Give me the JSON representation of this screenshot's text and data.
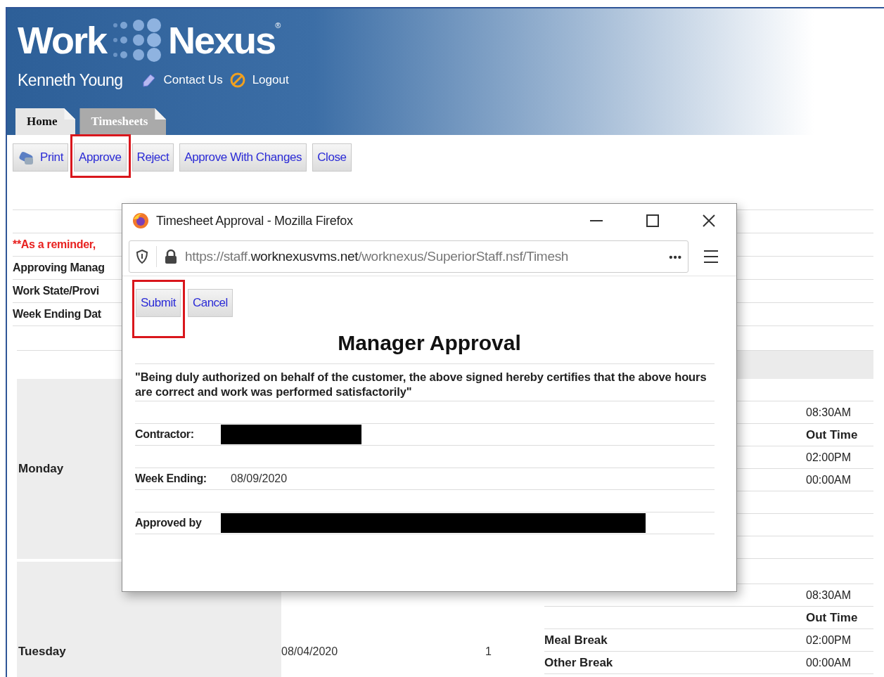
{
  "logo": {
    "word_1": "Work",
    "word_2": "Nexus",
    "mark": "®"
  },
  "user": {
    "name": "Kenneth Young",
    "links": [
      "Contact Us",
      "Logout"
    ]
  },
  "tabs": [
    {
      "label": "Home",
      "selected": true
    },
    {
      "label": "Timesheets",
      "selected": false
    }
  ],
  "toolbar": [
    {
      "label": "Print",
      "kind": "print",
      "highlighted": false
    },
    {
      "label": "Approve",
      "kind": "plain",
      "highlighted": true
    },
    {
      "label": "Reject",
      "kind": "plain",
      "highlighted": false
    },
    {
      "label": "Approve With Changes",
      "kind": "plain",
      "highlighted": false
    },
    {
      "label": "Close",
      "kind": "plain",
      "highlighted": false
    }
  ],
  "reminder": "**As a reminder,",
  "info_labels": [
    "Approving Manag",
    "Work State/Provi",
    "Week Ending Dat"
  ],
  "days": [
    {
      "day": "Monday",
      "rows": [
        {
          "kind": "value",
          "time": "08:30AM"
        },
        {
          "kind": "heading",
          "time": "Out Time"
        },
        {
          "kind": "value",
          "time": "02:00PM"
        },
        {
          "kind": "value",
          "time": "00:00AM"
        }
      ]
    },
    {
      "day": "Tuesday",
      "date": "08/04/2020",
      "count": "1",
      "rows": [
        {
          "kind": "value",
          "time": "08:30AM"
        },
        {
          "kind": "heading",
          "time": "Out Time"
        },
        {
          "kind": "value",
          "label": "Meal Break",
          "time": "02:00PM"
        },
        {
          "kind": "value",
          "label": "Other Break",
          "time": "00:00AM"
        }
      ]
    }
  ],
  "dialog": {
    "title": "Timesheet Approval - Mozilla Firefox",
    "url": {
      "prefix": "https://staff.",
      "domain": "worknexusvms.net",
      "path": "/worknexus/SuperiorStaff.nsf/Timesh"
    },
    "page_actions": "•••",
    "buttons": [
      {
        "label": "Submit",
        "highlighted": true
      },
      {
        "label": "Cancel",
        "highlighted": false
      }
    ],
    "heading": "Manager Approval",
    "statement": "\"Being duly authorized on behalf of the customer, the above signed hereby certifies that the above hours are correct and work was performed satisfactorily\"",
    "fields": [
      {
        "label": "Contractor:",
        "redacted": true
      },
      {
        "label": "Week Ending:",
        "value": "08/09/2020",
        "redacted": false
      },
      {
        "label": "Approved by",
        "redacted": true
      }
    ]
  }
}
